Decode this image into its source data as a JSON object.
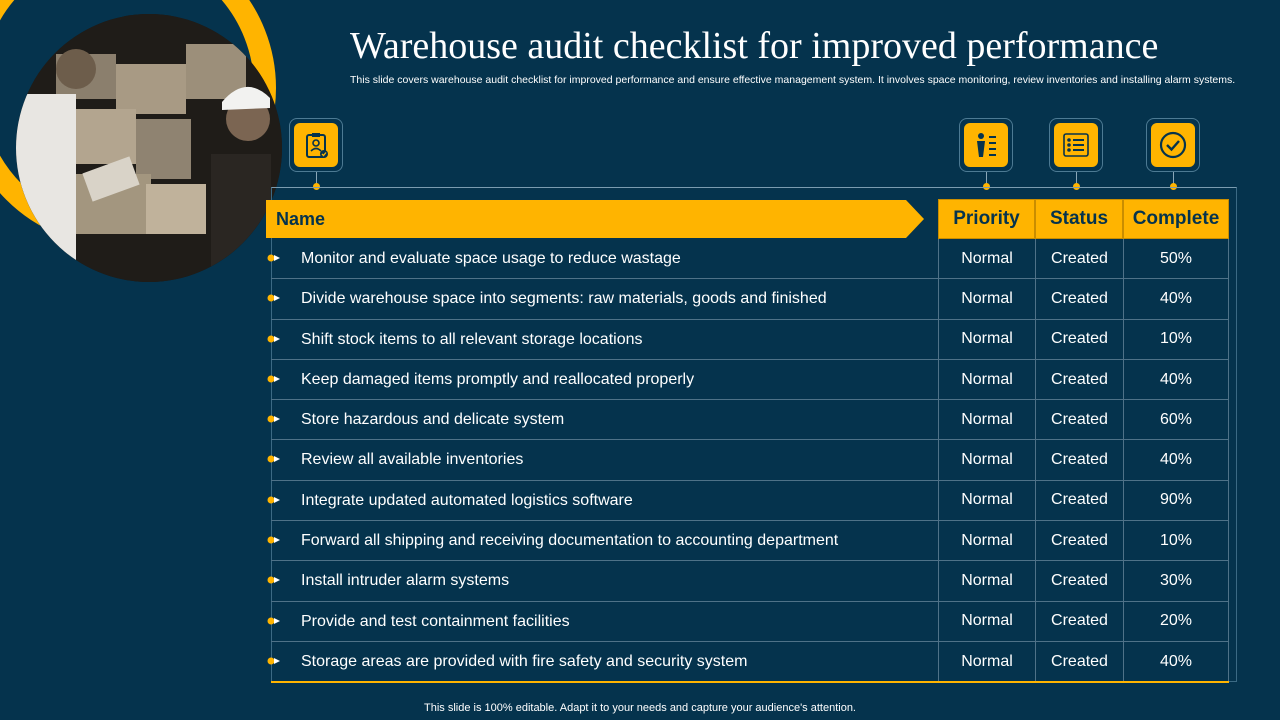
{
  "title": "Warehouse audit checklist for improved performance",
  "subtitle": "This slide covers warehouse audit checklist for improved performance and ensure effective management system. It involves space monitoring, review inventories and installing alarm systems.",
  "table": {
    "headers": {
      "name": "Name",
      "priority": "Priority",
      "status": "Status",
      "complete": "Complete"
    },
    "rows": [
      {
        "task": "Monitor and evaluate  space usage to reduce wastage",
        "priority": "Normal",
        "status": "Created",
        "complete": "50%"
      },
      {
        "task": "Divide warehouse space into segments: raw materials, goods and finished",
        "priority": "Normal",
        "status": "Created",
        "complete": "40%"
      },
      {
        "task": "Shift stock items to all relevant storage locations",
        "priority": "Normal",
        "status": "Created",
        "complete": "10%"
      },
      {
        "task": "Keep damaged items promptly and reallocated properly",
        "priority": "Normal",
        "status": "Created",
        "complete": "40%"
      },
      {
        "task": "Store hazardous and delicate system",
        "priority": "Normal",
        "status": "Created",
        "complete": "60%"
      },
      {
        "task": "Review all available inventories",
        "priority": "Normal",
        "status": "Created",
        "complete": "40%"
      },
      {
        "task": "Integrate updated automated logistics software",
        "priority": "Normal",
        "status": "Created",
        "complete": "90%"
      },
      {
        "task": "Forward all shipping and receiving documentation to accounting department",
        "priority": "Normal",
        "status": "Created",
        "complete": "10%"
      },
      {
        "task": "Install intruder alarm systems",
        "priority": "Normal",
        "status": "Created",
        "complete": "30%"
      },
      {
        "task": "Provide and test containment facilities",
        "priority": "Normal",
        "status": "Created",
        "complete": "20%"
      },
      {
        "task": "Storage areas are  provided with fire safety and security system",
        "priority": "Normal",
        "status": "Created",
        "complete": "40%"
      }
    ]
  },
  "icons": {
    "name": "clipboard-badge-icon",
    "priority": "person-priority-list-icon",
    "status": "checklist-icon",
    "complete": "check-circle-icon"
  },
  "colors": {
    "background": "#05334d",
    "accent": "#ffb400",
    "text": "#ffffff"
  },
  "footer": "This slide is 100% editable. Adapt it to your needs and capture your audience's attention."
}
